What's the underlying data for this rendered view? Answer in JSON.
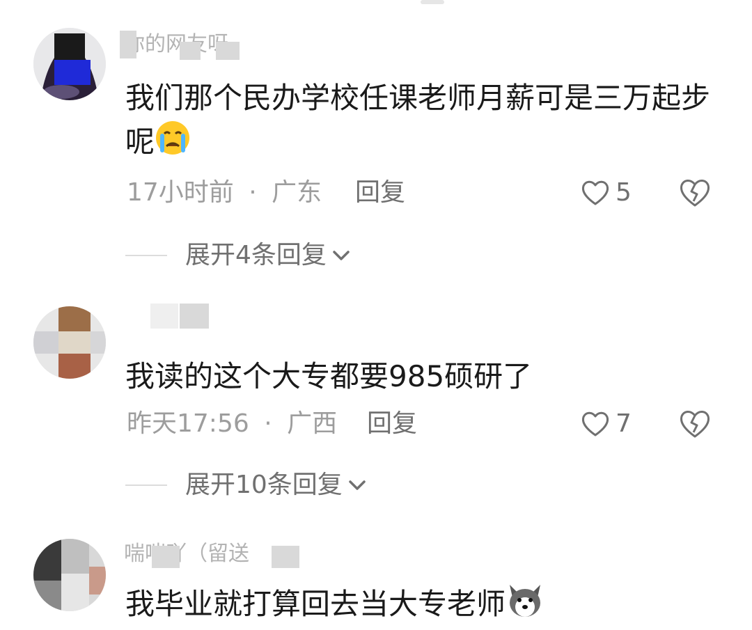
{
  "comments": [
    {
      "username": "你的网友呀",
      "text": "我们那个民办学校任课老师月薪可是三万起步呢",
      "emoji": "crying-face-emoji",
      "time": "17小时前",
      "separator": "·",
      "location": "广东",
      "reply_label": "回复",
      "likes": "5",
      "expand_label": "展开4条回复"
    },
    {
      "username": "",
      "text": "我读的这个大专都要985硕研了",
      "time": "昨天17:56",
      "separator": "·",
      "location": "广西",
      "reply_label": "回复",
      "likes": "7",
      "expand_label": "展开10条回复"
    },
    {
      "username": "喘喘吖（留送",
      "text": "我毕业就打算回去当大专老师",
      "emoji": "husky-dog-emoji"
    }
  ],
  "colors": {
    "text": "#1a1a1a",
    "meta": "#9d9d9d",
    "action": "#707070"
  }
}
